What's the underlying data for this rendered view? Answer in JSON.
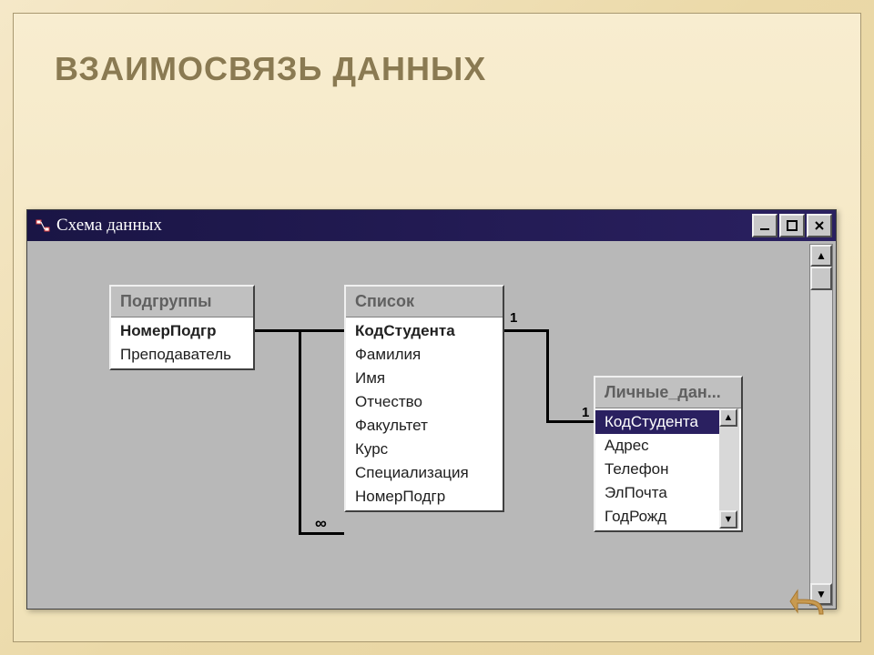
{
  "slide": {
    "title": "ВЗАИМОСВЯЗЬ ДАННЫХ"
  },
  "window": {
    "title": "Схема данных",
    "controls": {
      "minimize": "_",
      "maximize": "□",
      "close": "✕"
    }
  },
  "tables": {
    "podgruppy": {
      "title": "Подгруппы",
      "fields": [
        "НомерПодгр",
        "Преподаватель"
      ],
      "pk_index": 0
    },
    "spisok": {
      "title": "Список",
      "fields": [
        "КодСтудента",
        "Фамилия",
        "Имя",
        "Отчество",
        "Факультет",
        "Курс",
        "Специализация",
        "НомерПодгр"
      ],
      "pk_index": 0
    },
    "lichnye": {
      "title": "Личные_дан...",
      "fields": [
        "КодСтудента",
        "Адрес",
        "Телефон",
        "ЭлПочта",
        "ГодРожд"
      ],
      "selected_index": 0
    }
  },
  "relations": {
    "r1_left": "1",
    "r1_right": "∞",
    "r2_left": "1",
    "r2_right": "1"
  },
  "scroll": {
    "up": "▲",
    "down": "▼"
  }
}
